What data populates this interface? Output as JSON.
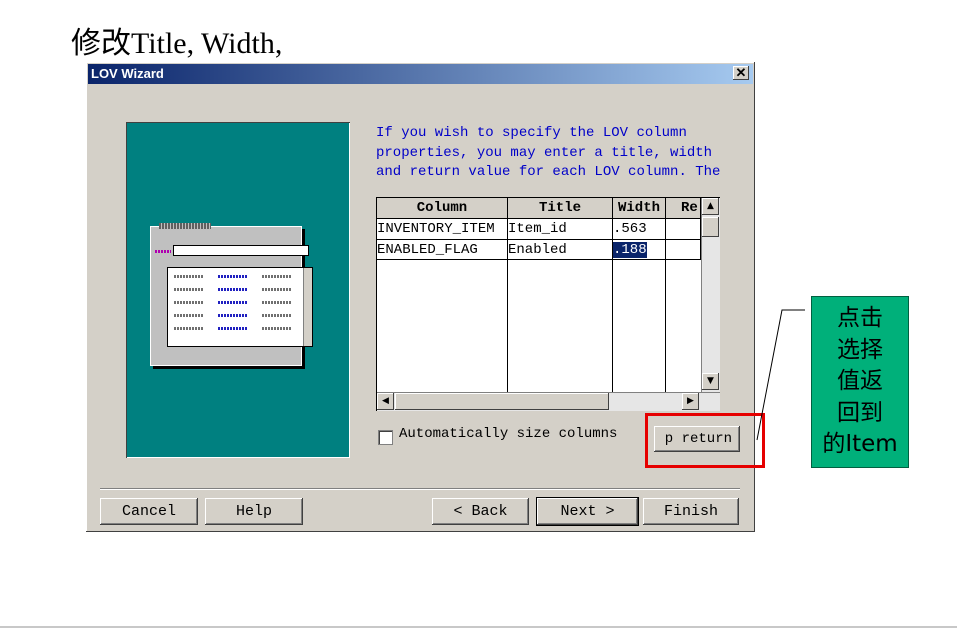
{
  "slide": {
    "title": "修改Title, Width,"
  },
  "dialog": {
    "title": "LOV Wizard",
    "close_glyph": "✕",
    "instruction_text": "If you wish to specify the LOV column properties, you may enter a title, width and return value for each LOV column. The return value is the item which",
    "grid": {
      "headers": [
        "Column",
        "Title",
        "Width",
        "Re"
      ],
      "rows": [
        {
          "column": "INVENTORY_ITEM",
          "title": "Item_id",
          "width": ".563",
          "return": ""
        },
        {
          "column": "ENABLED_FLAG",
          "title": "Enabled",
          "width": ".188",
          "return": ""
        }
      ]
    },
    "auto_size_label": "Automatically size columns",
    "return_button_label": "p return",
    "buttons": {
      "cancel": "Cancel",
      "help": "Help",
      "back": "< Back",
      "next": "Next >",
      "finish": "Finish"
    }
  },
  "callout": {
    "lines": [
      "点击",
      "选择",
      "值返",
      "回到",
      "的Item"
    ]
  },
  "colors": {
    "titlebar_start": "#0a246a",
    "titlebar_end": "#a6caf0",
    "illustration_bg": "#008080",
    "instruction_text": "#0000c8",
    "highlight_box": "#e60000",
    "callout_bg": "#00b07a",
    "dialog_bg": "#d4d0c8"
  }
}
